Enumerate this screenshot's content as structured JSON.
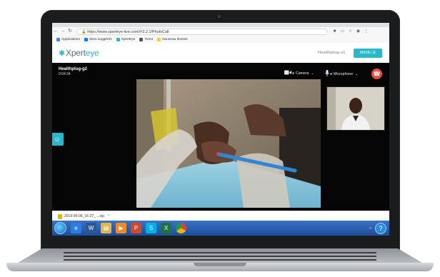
{
  "browser": {
    "url": "https://www.xperteye-live.com/#/2.2.1/PhotoCall",
    "toolbar_icons": [
      "record-icon",
      "cast-icon",
      "star-icon",
      "account-icon",
      "menu-dots-icon"
    ],
    "bookmarks": [
      {
        "label": "Applications",
        "icon": "apps-grid-icon",
        "color": "#4285f4"
      },
      {
        "label": "Sites suggérés",
        "icon": "bookmark-icon",
        "color": "#1a73e8"
      },
      {
        "label": "XpertEye",
        "icon": "bookmark-icon",
        "color": "#2ab7c9"
      },
      {
        "label": "Tom3",
        "icon": "globe-icon",
        "color": "#555555"
      },
      {
        "label": "Nouveau dossier",
        "icon": "folder-icon",
        "color": "#f2c94c"
      }
    ]
  },
  "app": {
    "logo_prefix": "Xpert",
    "logo_suffix": "eye",
    "device_title": "Healthplug-s1",
    "menu_label": "MENU ☰"
  },
  "call": {
    "peer_name": "Healthplug-g2",
    "timer": "0:04:34",
    "camera_label": "Camera",
    "microphone_label": "Microphone",
    "accent_color": "#2ab7c9",
    "hangup_color": "#e8533f"
  },
  "downloads": {
    "filename": "2019-06-06_16-27_....zip"
  },
  "taskbar": {
    "apps": [
      {
        "icon": "ie-icon",
        "color": "#2b7de0"
      },
      {
        "icon": "word-icon",
        "color": "#2b5797"
      },
      {
        "icon": "explorer-icon",
        "color": "#e6b54a"
      },
      {
        "icon": "media-player-icon",
        "color": "#f08a24"
      },
      {
        "icon": "powerpoint-icon",
        "color": "#d24726"
      },
      {
        "icon": "skype-icon",
        "color": "#00aff0"
      },
      {
        "icon": "excel-icon",
        "color": "#207245"
      },
      {
        "icon": "chrome-icon",
        "color": "#ffffff"
      }
    ],
    "tray_text": "»"
  }
}
